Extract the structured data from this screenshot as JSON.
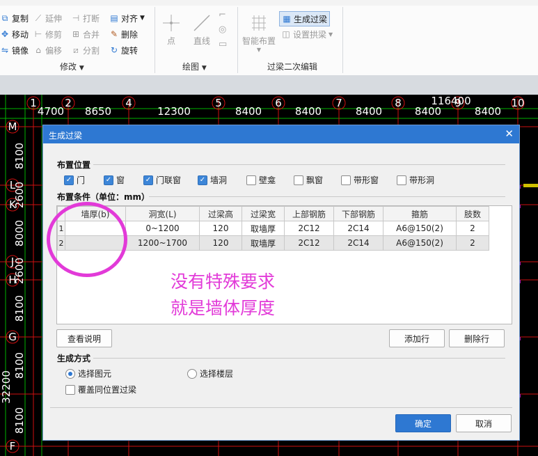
{
  "ribbon": {
    "modify": {
      "items": [
        {
          "label": "复制",
          "icon": "copy-icon",
          "enabled": true
        },
        {
          "label": "延伸",
          "icon": "extend-icon",
          "enabled": false
        },
        {
          "label": "打断",
          "icon": "break-icon",
          "enabled": false
        },
        {
          "label": "对齐",
          "icon": "align-icon",
          "enabled": true
        },
        {
          "label": "移动",
          "icon": "move-icon",
          "enabled": true
        },
        {
          "label": "修剪",
          "icon": "trim-icon",
          "enabled": false
        },
        {
          "label": "合并",
          "icon": "merge-icon",
          "enabled": false
        },
        {
          "label": "删除",
          "icon": "delete-icon",
          "enabled": true
        },
        {
          "label": "镜像",
          "icon": "mirror-icon",
          "enabled": true
        },
        {
          "label": "偏移",
          "icon": "offset-icon",
          "enabled": false
        },
        {
          "label": "分割",
          "icon": "split-icon",
          "enabled": false
        },
        {
          "label": "旋转",
          "icon": "rotate-icon",
          "enabled": true
        }
      ],
      "label": "修改"
    },
    "draw": {
      "point": "点",
      "line": "直线",
      "label": "绘图"
    },
    "lintel": {
      "smart_layout": "智能布置",
      "generate": "生成过梁",
      "set_arch": "设置拱梁",
      "label": "过梁二次编辑"
    }
  },
  "cad": {
    "top_axes": [
      "1",
      "2",
      "4",
      "5",
      "6",
      "7",
      "8",
      "9",
      "10"
    ],
    "top_dims": [
      "4700",
      "8650",
      "12300",
      "8400",
      "8400",
      "8400",
      "8400",
      "8400"
    ],
    "top_total": "116400",
    "left_axes": [
      "M",
      "L",
      "K",
      "J",
      "H",
      "G",
      "F"
    ],
    "left_dims": [
      "8100",
      "2600",
      "8000",
      "2600",
      "8100",
      "8100",
      "8100"
    ],
    "left_extra": "32200"
  },
  "dialog": {
    "title": "生成过梁",
    "placement_title": "布置位置",
    "placement": [
      {
        "label": "门",
        "checked": true
      },
      {
        "label": "窗",
        "checked": true
      },
      {
        "label": "门联窗",
        "checked": true
      },
      {
        "label": "墙洞",
        "checked": true
      },
      {
        "label": "壁龛",
        "checked": false
      },
      {
        "label": "飘窗",
        "checked": false
      },
      {
        "label": "带形窗",
        "checked": false
      },
      {
        "label": "带形洞",
        "checked": false
      }
    ],
    "conditions_title": "布置条件（单位：mm）",
    "columns": [
      "墙厚(b)",
      "洞宽(L)",
      "过梁高",
      "过梁宽",
      "上部钢筋",
      "下部钢筋",
      "箍筋",
      "肢数"
    ],
    "rows": [
      {
        "no": "1",
        "cells": [
          "",
          "0~1200",
          "120",
          "取墙厚",
          "2C12",
          "2C14",
          "A6@150(2)",
          "2"
        ]
      },
      {
        "no": "2",
        "cells": [
          "",
          "1200~1700",
          "120",
          "取墙厚",
          "2C12",
          "2C14",
          "A6@150(2)",
          "2"
        ]
      }
    ],
    "view_help": "查看说明",
    "add_row": "添加行",
    "delete_row": "删除行",
    "method_title": "生成方式",
    "radio_select_element": "选择图元",
    "radio_select_floor": "选择楼层",
    "overwrite_label": "覆盖同位置过梁",
    "ok": "确定",
    "cancel": "取消"
  },
  "annotation": {
    "line1": "没有特殊要求",
    "line2": "就是墙体厚度",
    "color": "#e23ad8"
  }
}
